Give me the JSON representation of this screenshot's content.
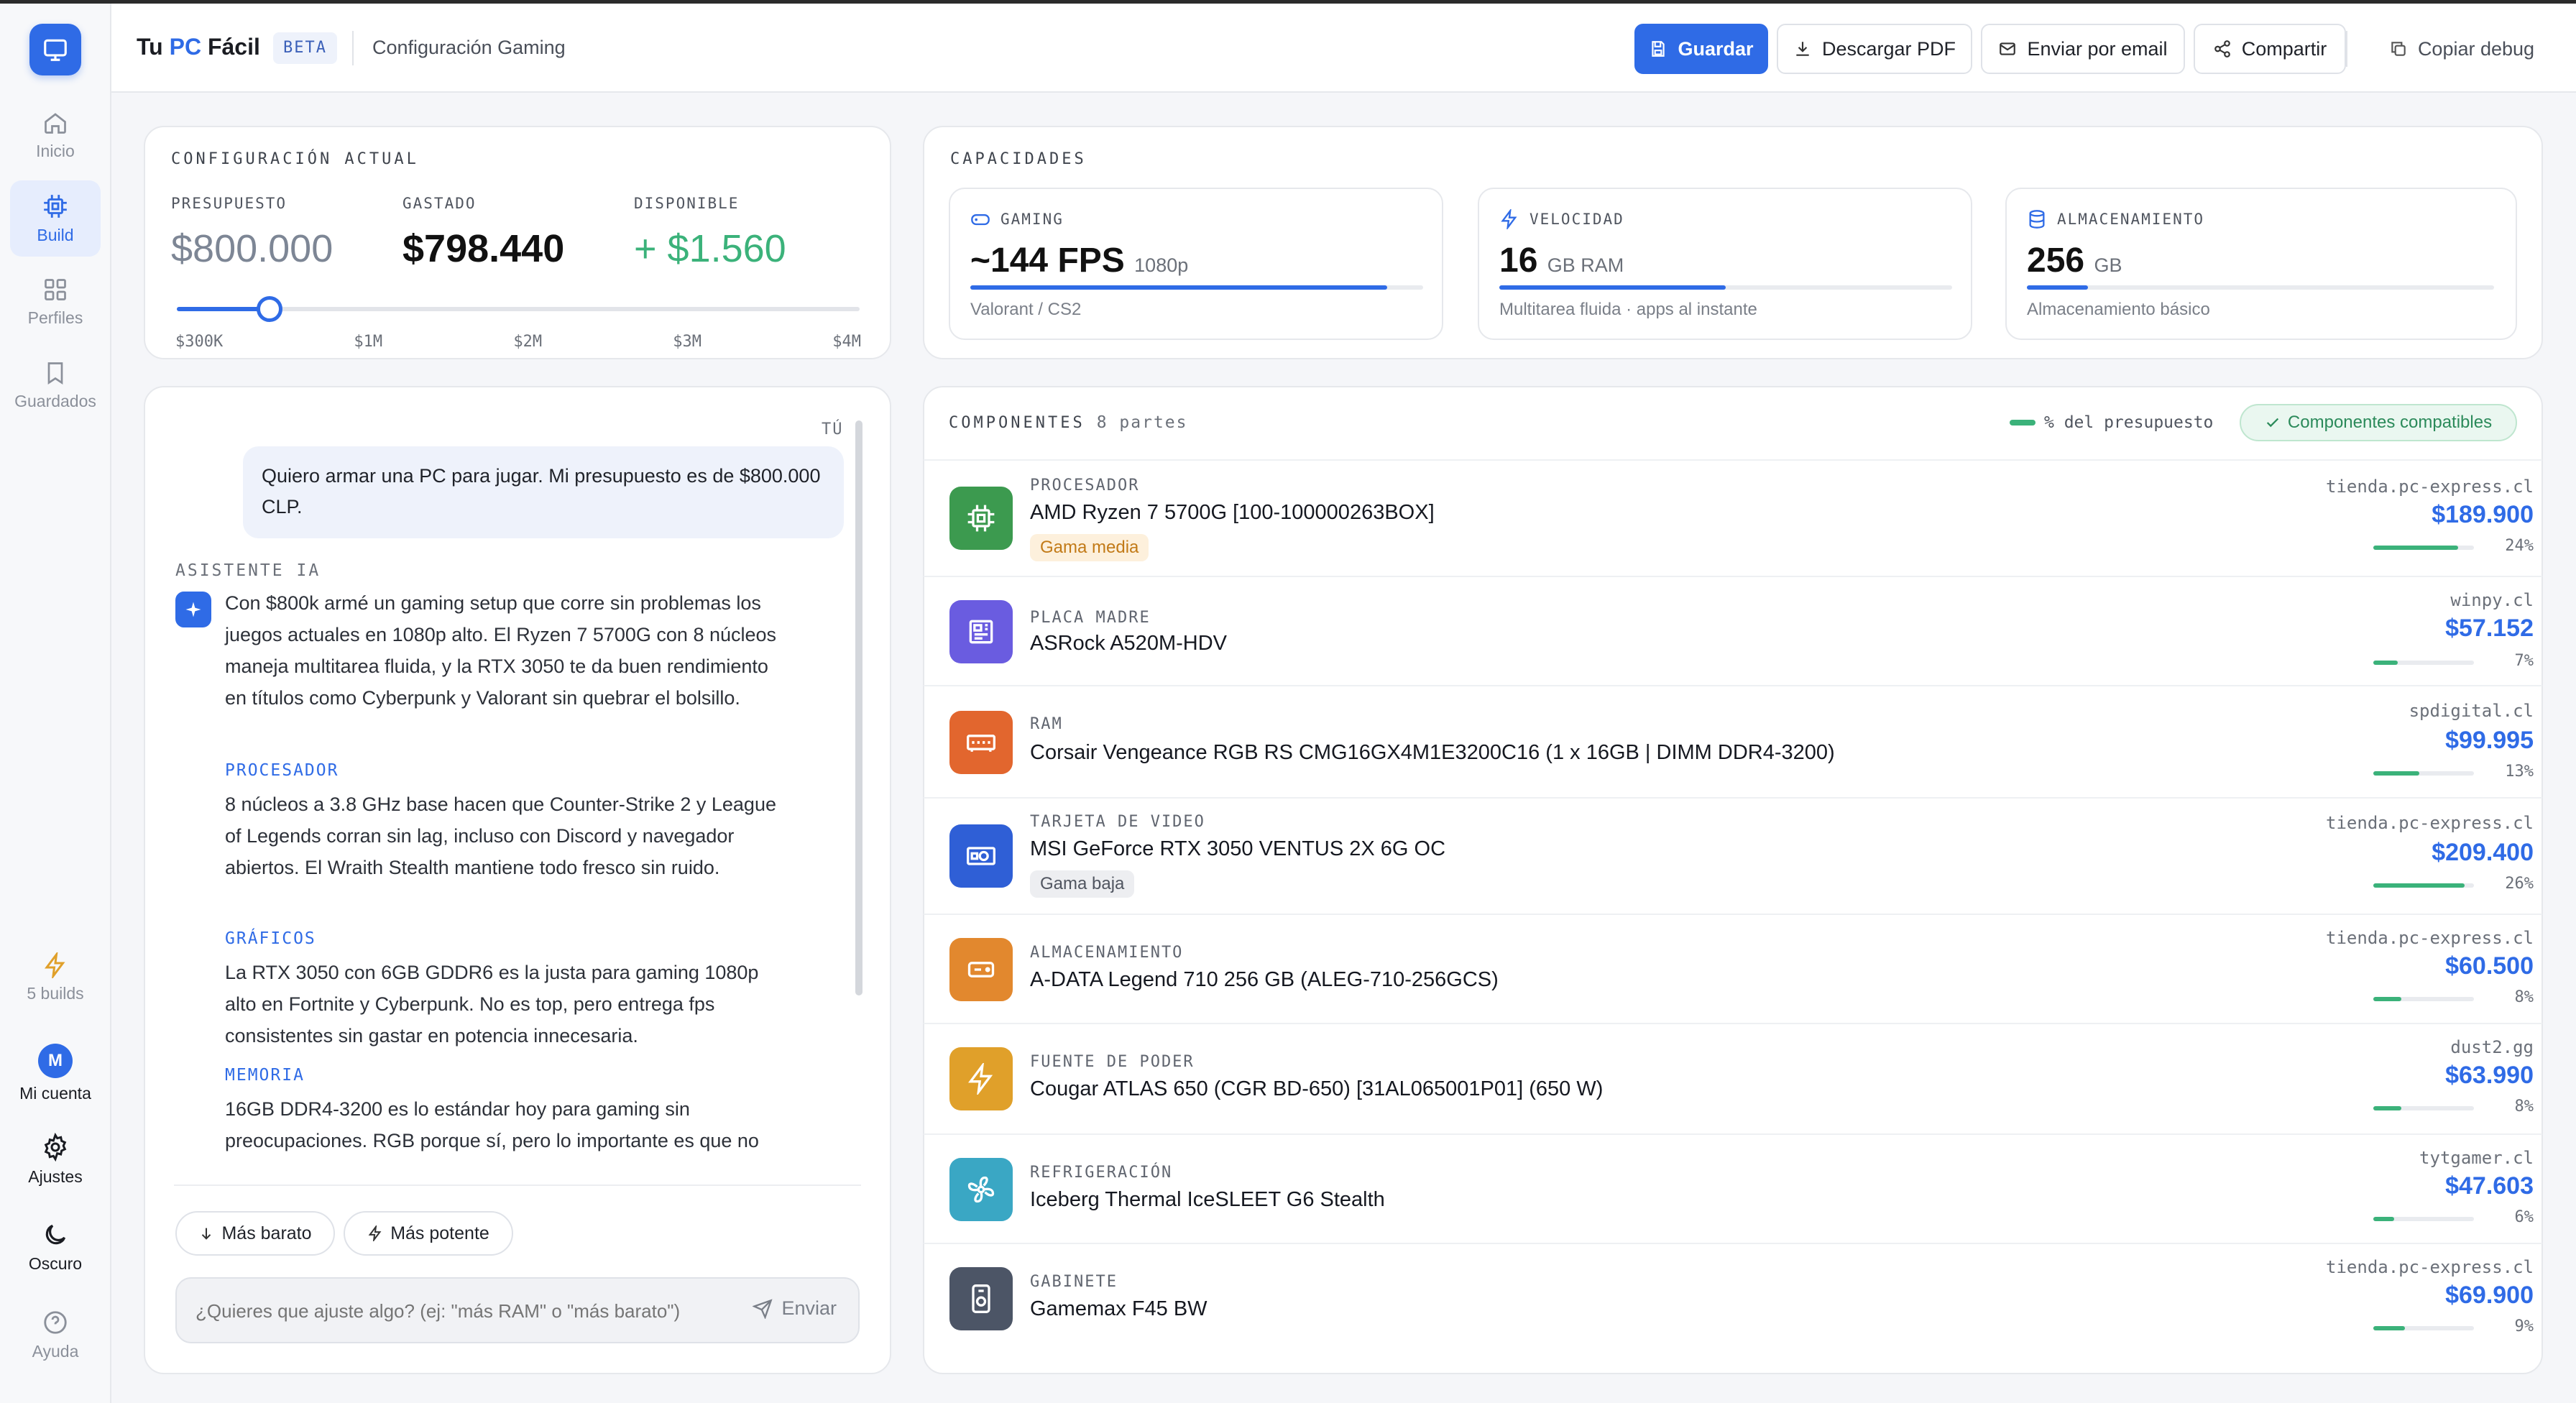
{
  "app": {
    "brand_pre": "Tu ",
    "brand_pc": "PC",
    "brand_post": " Fácil",
    "beta": "BETA",
    "subtitle": "Configuración Gaming"
  },
  "sidebar": {
    "items": [
      {
        "label": "Inicio",
        "icon": "home-icon"
      },
      {
        "label": "Build",
        "icon": "cpu-icon"
      },
      {
        "label": "Perfiles",
        "icon": "grid-icon"
      },
      {
        "label": "Guardados",
        "icon": "bookmark-icon"
      }
    ],
    "builds": "5 builds",
    "avatar": "M",
    "account": "Mi cuenta",
    "settings": "Ajustes",
    "dark": "Oscuro",
    "help": "Ayuda"
  },
  "toolbar": {
    "save": "Guardar",
    "pdf": "Descargar PDF",
    "email": "Enviar por email",
    "share": "Compartir",
    "debug": "Copiar debug"
  },
  "config": {
    "title": "CONFIGURACIÓN ACTUAL",
    "budget_label": "PRESUPUESTO",
    "budget": "$800.000",
    "spent_label": "GASTADO",
    "spent": "$798.440",
    "available_label": "DISPONIBLE",
    "available": "+ $1.560",
    "slider_ticks": [
      "$300K",
      "$1M",
      "$2M",
      "$3M",
      "$4M"
    ],
    "slider_fraction": 0.136
  },
  "capacities": {
    "title": "CAPACIDADES",
    "items": [
      {
        "label": "GAMING",
        "value": "~144 FPS",
        "unit": "1080p",
        "desc": "Valorant / CS2",
        "fill": 0.92
      },
      {
        "label": "VELOCIDAD",
        "value": "16",
        "unit": "GB RAM",
        "desc": "Multitarea fluida · apps al instante",
        "fill": 0.5
      },
      {
        "label": "ALMACENAMIENTO",
        "value": "256",
        "unit": "GB",
        "desc": "Almacenamiento básico",
        "fill": 0.13
      }
    ]
  },
  "chat": {
    "you": "TÚ",
    "user_msg": "Quiero armar una PC para jugar. Mi presupuesto es de $800.000 CLP.",
    "assistant_label": "ASISTENTE IA",
    "intro": "Con $800k armé un gaming setup que corre sin problemas los juegos actuales en 1080p alto. El Ryzen 7 5700G con 8 núcleos maneja multitarea fluida, y la RTX 3050 te da buen rendimiento en títulos como Cyberpunk y Valorant sin quebrar el bolsillo.",
    "s1_title": "PROCESADOR",
    "s1_text": "8 núcleos a 3.8 GHz base hacen que Counter-Strike 2 y League of Legends corran sin lag, incluso con Discord y navegador abiertos. El Wraith Stealth mantiene todo fresco sin ruido.",
    "s2_title": "GRÁFICOS",
    "s2_text": "La RTX 3050 con 6GB GDDR6 es la justa para gaming 1080p alto en Fortnite y Cyberpunk. No es top, pero entrega fps consistentes sin gastar en potencia innecesaria.",
    "s3_title": "MEMORIA",
    "s3_text": "16GB DDR4-3200 es lo estándar hoy para gaming sin preocupaciones. RGB porque sí, pero lo importante es que no",
    "cheaper": "Más barato",
    "stronger": "Más potente",
    "placeholder": "¿Quieres que ajuste algo? (ej: \"más RAM\" o \"más barato\")",
    "send": "Enviar"
  },
  "components": {
    "title": "COMPONENTES",
    "count": "8 partes",
    "legend": "% del presupuesto",
    "compatible": "Componentes compatibles",
    "items": [
      {
        "category": "PROCESADOR",
        "name": "AMD Ryzen 7 5700G [100-100000263BOX]",
        "tag": "Gama media",
        "store": "tienda.pc-express.cl",
        "price": "$189.900",
        "pct": "24%",
        "color": "#3c9a4f",
        "icon": "cpu-icon"
      },
      {
        "category": "PLACA MADRE",
        "name": "ASRock A520M-HDV",
        "tag": "",
        "store": "winpy.cl",
        "price": "$57.152",
        "pct": "7%",
        "color": "#6a5ce0",
        "icon": "motherboard-icon"
      },
      {
        "category": "RAM",
        "name": "Corsair Vengeance RGB RS CMG16GX4M1E3200C16 (1 x 16GB | DIMM DDR4-3200)",
        "tag": "",
        "store": "spdigital.cl",
        "price": "$99.995",
        "pct": "13%",
        "color": "#e2662e",
        "icon": "memory-icon"
      },
      {
        "category": "TARJETA DE VIDEO",
        "name": "MSI GeForce RTX 3050 VENTUS 2X 6G OC",
        "tag": "Gama baja",
        "store": "tienda.pc-express.cl",
        "price": "$209.400",
        "pct": "26%",
        "color": "#2f5fd6",
        "icon": "gpu-icon"
      },
      {
        "category": "ALMACENAMIENTO",
        "name": "A-DATA Legend 710 256 GB (ALEG-710-256GCS)",
        "tag": "",
        "store": "tienda.pc-express.cl",
        "price": "$60.500",
        "pct": "8%",
        "color": "#e2882e",
        "icon": "drive-icon"
      },
      {
        "category": "FUENTE DE PODER",
        "name": "Cougar ATLAS 650 (CGR BD-650) [31AL065001P01] (650 W)",
        "tag": "",
        "store": "dust2.gg",
        "price": "$63.990",
        "pct": "8%",
        "color": "#e0a02a",
        "icon": "bolt-icon"
      },
      {
        "category": "REFRIGERACIÓN",
        "name": "Iceberg Thermal IceSLEET G6 Stealth",
        "tag": "",
        "store": "tytgamer.cl",
        "price": "$47.603",
        "pct": "6%",
        "color": "#3aa7c4",
        "icon": "fan-icon"
      },
      {
        "category": "GABINETE",
        "name": "Gamemax F45 BW",
        "tag": "",
        "store": "tienda.pc-express.cl",
        "price": "$69.900",
        "pct": "9%",
        "color": "#4c5566",
        "icon": "case-icon"
      }
    ]
  }
}
